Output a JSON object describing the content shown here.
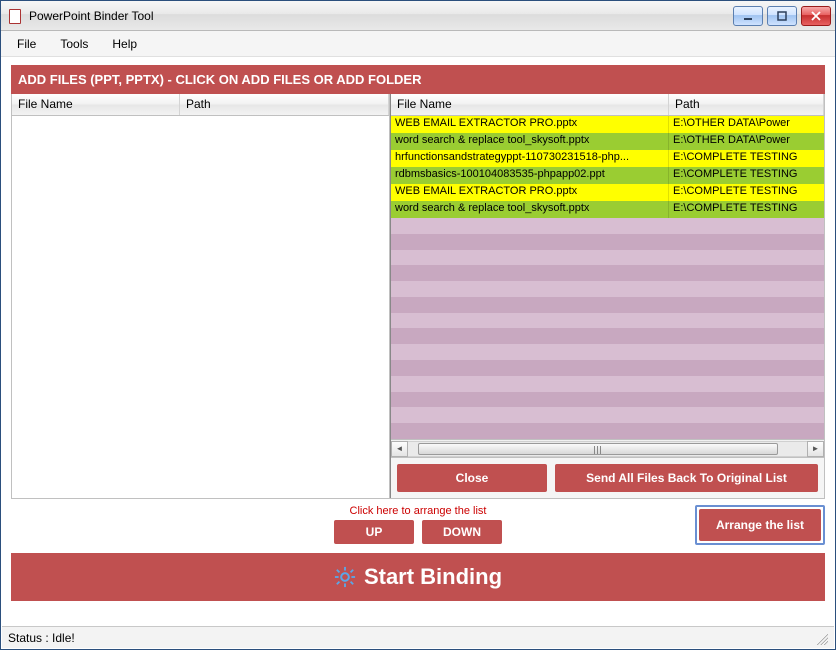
{
  "window": {
    "title": "PowerPoint Binder Tool"
  },
  "menu": {
    "file": "File",
    "tools": "Tools",
    "help": "Help"
  },
  "section": {
    "header": "ADD FILES (PPT, PPTX) - CLICK ON ADD FILES OR ADD FOLDER"
  },
  "columns": {
    "filename": "File Name",
    "path": "Path"
  },
  "right_grid": {
    "rows": [
      {
        "name": "WEB EMAIL EXTRACTOR PRO.pptx",
        "path": "E:\\OTHER DATA\\Power",
        "color": "yellow"
      },
      {
        "name": "word search & replace tool_skysoft.pptx",
        "path": "E:\\OTHER DATA\\Power",
        "color": "green"
      },
      {
        "name": "hrfunctionsandstrategyppt-110730231518-php...",
        "path": "E:\\COMPLETE TESTING",
        "color": "yellow"
      },
      {
        "name": "rdbmsbasics-100104083535-phpapp02.ppt",
        "path": "E:\\COMPLETE TESTING",
        "color": "green"
      },
      {
        "name": "WEB EMAIL EXTRACTOR PRO.pptx",
        "path": "E:\\COMPLETE TESTING",
        "color": "yellow"
      },
      {
        "name": "word search & replace tool_skysoft.pptx",
        "path": "E:\\COMPLETE TESTING",
        "color": "green"
      }
    ]
  },
  "buttons": {
    "close": "Close",
    "send_back": "Send All Files Back To Original List",
    "arrange_hint": "Click here to arrange the list",
    "up": "UP",
    "down": "DOWN",
    "arrange": "Arrange the list",
    "start": "Start Binding"
  },
  "status": {
    "text": "Status  :  Idle!"
  },
  "colors": {
    "primary": "#c05050",
    "highlight_border": "#6a8fd2"
  }
}
